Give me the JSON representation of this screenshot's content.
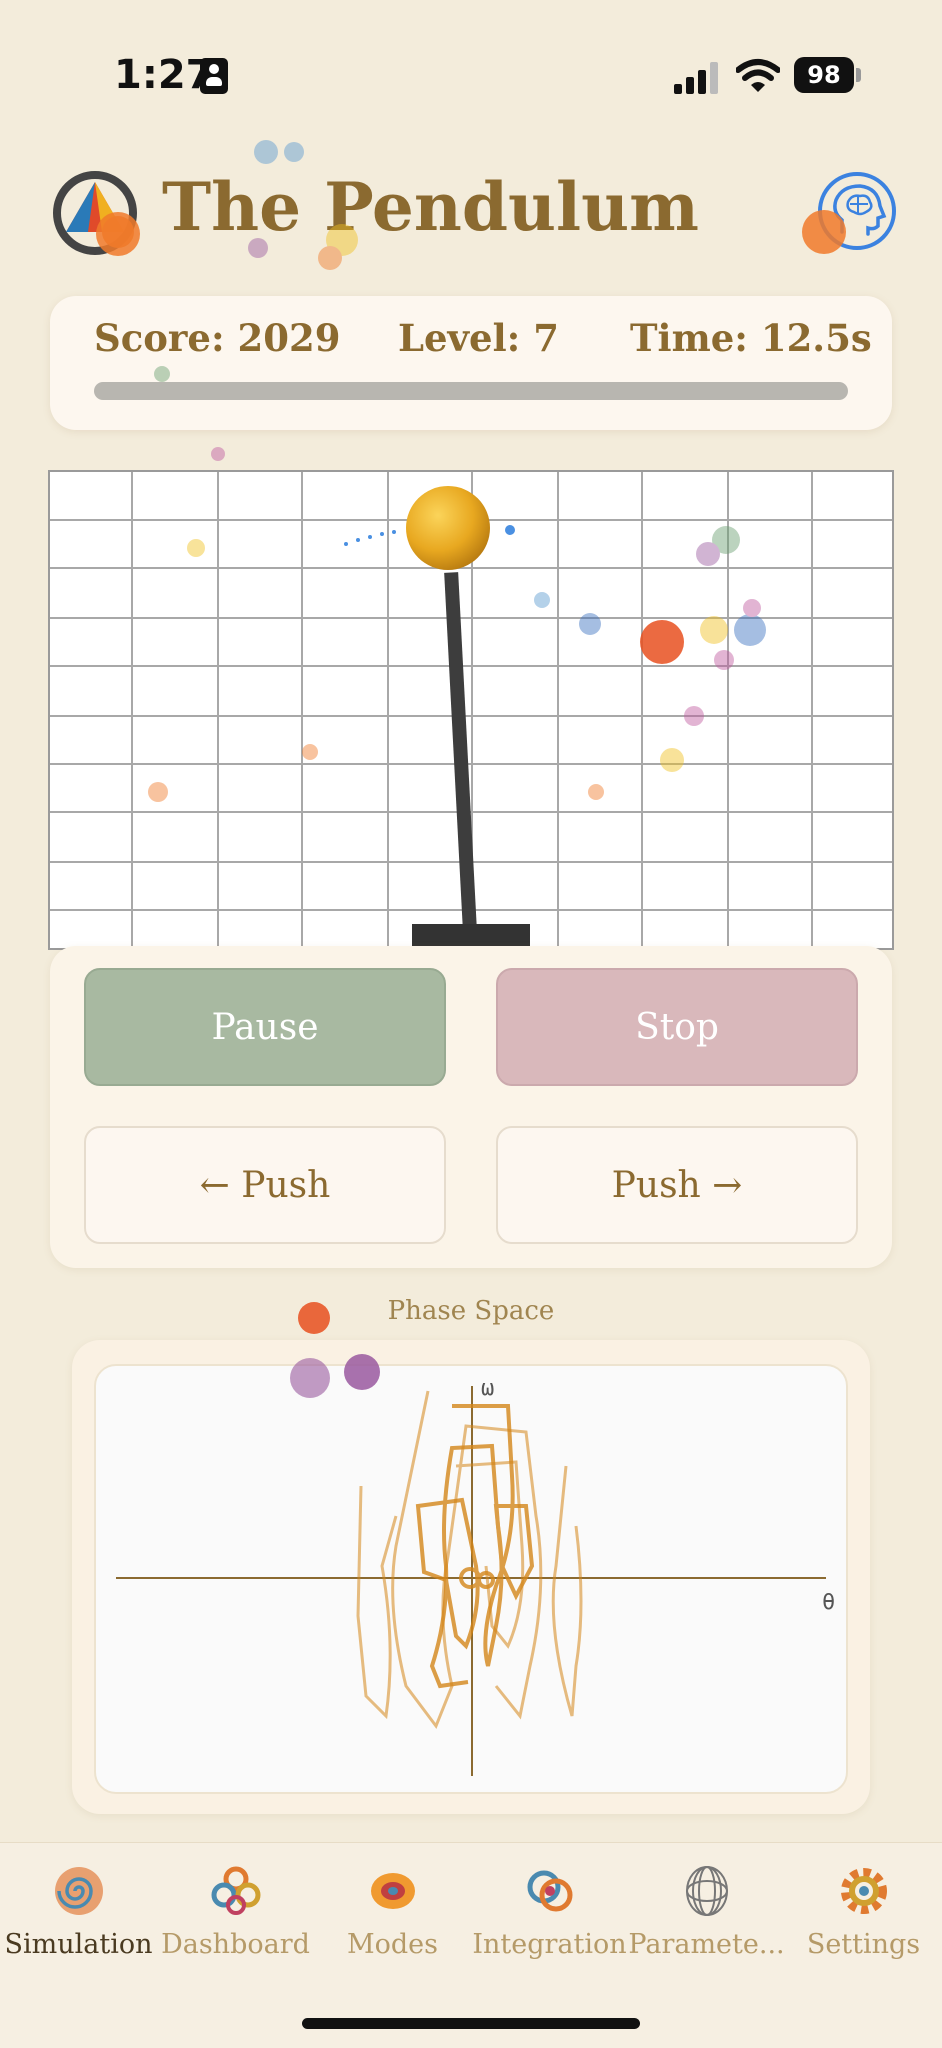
{
  "status": {
    "time": "1:27",
    "battery": "98"
  },
  "header": {
    "title": "The Pendulum"
  },
  "score": {
    "score_text": "Score: 2029",
    "level_text": "Level: 7",
    "time_text": "Time: 12.5s",
    "progress_fraction": 0.0
  },
  "controls": {
    "pause": "Pause",
    "stop": "Stop",
    "push_left": "← Push",
    "push_right": "Push →"
  },
  "phase": {
    "label": "Phase Space",
    "y_axis": "ω",
    "x_axis": "θ"
  },
  "tabs": [
    {
      "label": "Simulation",
      "icon": "spiral-icon"
    },
    {
      "label": "Dashboard",
      "icon": "dashboard-icon"
    },
    {
      "label": "Modes",
      "icon": "modes-icon"
    },
    {
      "label": "Integration",
      "icon": "integration-icon"
    },
    {
      "label": "Paramete...",
      "icon": "parameters-icon"
    },
    {
      "label": "Settings",
      "icon": "gear-icon"
    }
  ],
  "colors": {
    "accent": "#8b6a30",
    "pause": "#a8b9a1",
    "stop": "#d9b8bb",
    "trajectory": "#d4861a",
    "bob": "#e8a820"
  }
}
